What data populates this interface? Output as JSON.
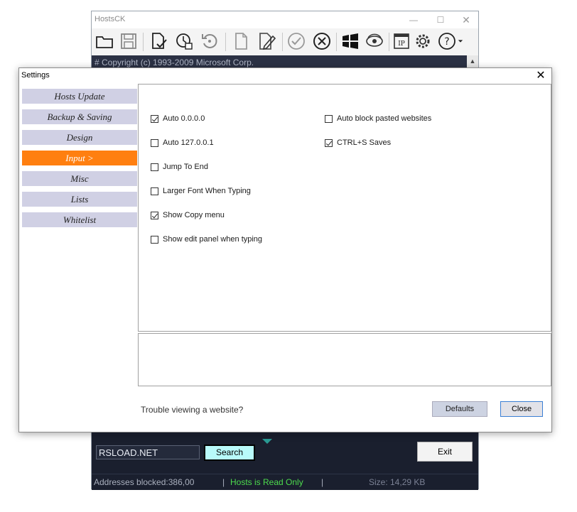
{
  "hostsck": {
    "title": "HostsCK",
    "window_controls": {
      "minimize": "—",
      "maximize": "☐",
      "close": "✕"
    },
    "toolbar_icons": [
      "open-folder-icon",
      "save-icon",
      "check-file-icon",
      "check-clock-icon",
      "restore-icon",
      "blank-page-icon",
      "edit-page-icon",
      "check-circle-icon",
      "cancel-circle-icon",
      "windows-logo-icon",
      "refresh-eye-icon",
      "ip-icon",
      "gear-icon",
      "help-icon"
    ],
    "editor_line": "# Copyright (c) 1993-2009 Microsoft Corp.",
    "search_value": "RSLOAD.NET",
    "search_label": "Search",
    "exit_label": "Exit",
    "status": {
      "blocked": "Addresses blocked:386,00",
      "separator": "|",
      "read_only": "Hosts is Read Only",
      "size": "Size: 14,29 KB"
    },
    "colors": {
      "dark_bg": "#1c2233",
      "status_green": "#4ddb4d",
      "search_btn": "#b8fafa"
    }
  },
  "settings": {
    "title": "Settings",
    "close_glyph": "✕",
    "nav": [
      {
        "label": "Hosts Update"
      },
      {
        "label": "Backup & Saving"
      },
      {
        "label": "Design"
      },
      {
        "label": "Input   >"
      },
      {
        "label": "Misc"
      },
      {
        "label": "Lists"
      },
      {
        "label": "Whitelist"
      }
    ],
    "active_nav": "Input   >",
    "options_left": [
      {
        "label": "Auto 0.0.0.0",
        "checked": true
      },
      {
        "label": "Auto 127.0.0.1",
        "checked": false
      },
      {
        "label": "Jump To End",
        "checked": false
      },
      {
        "label": "Larger Font When Typing",
        "checked": false
      },
      {
        "label": "Show Copy menu",
        "checked": true
      },
      {
        "label": "Show edit panel when typing",
        "checked": false
      }
    ],
    "options_right": [
      {
        "label": "Auto block pasted websites",
        "checked": false
      },
      {
        "label": "CTRL+S Saves",
        "checked": true
      }
    ],
    "trouble_link": "Trouble viewing a website?",
    "defaults_label": "Defaults",
    "close_label": "Close",
    "colors": {
      "active_nav": "#ff7f10",
      "nav": "#d0d0e4"
    }
  }
}
